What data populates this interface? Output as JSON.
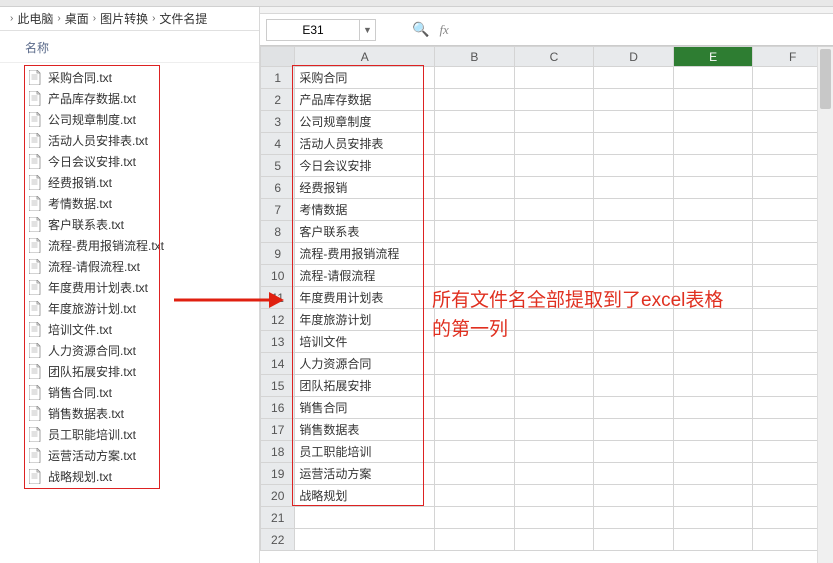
{
  "breadcrumb": {
    "items": [
      "此电脑",
      "桌面",
      "图片转换",
      "文件名提"
    ]
  },
  "explorer": {
    "name_header": "名称",
    "files": [
      "采购合同.txt",
      "产品库存数据.txt",
      "公司规章制度.txt",
      "活动人员安排表.txt",
      "今日会议安排.txt",
      "经费报销.txt",
      "考情数据.txt",
      "客户联系表.txt",
      "流程-费用报销流程.txt",
      "流程-请假流程.txt",
      "年度费用计划表.txt",
      "年度旅游计划.txt",
      "培训文件.txt",
      "人力资源合同.txt",
      "团队拓展安排.txt",
      "销售合同.txt",
      "销售数据表.txt",
      "员工职能培训.txt",
      "运营活动方案.txt",
      "战略规划.txt"
    ]
  },
  "sheet": {
    "name_box": "E31",
    "fx": "fx",
    "columns": [
      "A",
      "B",
      "C",
      "D",
      "E",
      "F"
    ],
    "selected_col_index": 4,
    "row_count": 22,
    "col_a": [
      "采购合同",
      "产品库存数据",
      "公司规章制度",
      "活动人员安排表",
      "今日会议安排",
      "经费报销",
      "考情数据",
      "客户联系表",
      "流程-费用报销流程",
      "流程-请假流程",
      "年度费用计划表",
      "年度旅游计划",
      "培训文件",
      "人力资源合同",
      "团队拓展安排",
      "销售合同",
      "销售数据表",
      "员工职能培训",
      "运营活动方案",
      "战略规划"
    ]
  },
  "annotation": {
    "line1": "所有文件名全部提取到了excel表格",
    "line2": "的第一列"
  }
}
